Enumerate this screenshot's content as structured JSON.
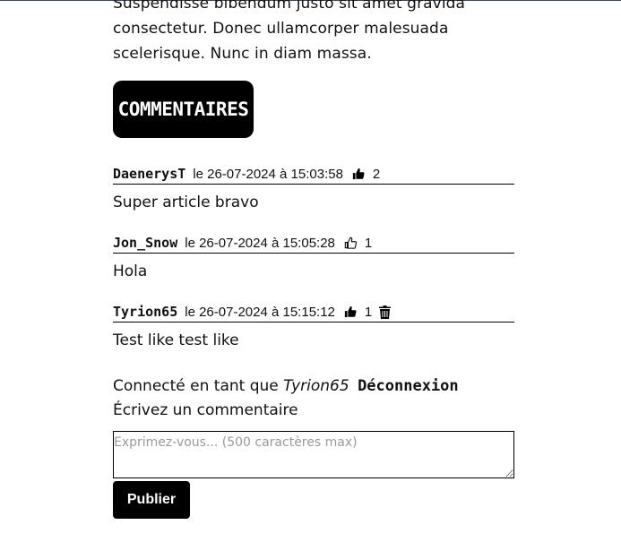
{
  "article": {
    "lines": [
      "Suspendisse bibendum justo sit amet gravida",
      "consectetur. Donec ullamcorper malesuada",
      "scelerisque. Nunc in diam massa."
    ]
  },
  "comments_section": {
    "heading": "COMMENTAIRES",
    "comments": [
      {
        "author": "DaenerysT",
        "date": "le 26-07-2024 à 15:03:58",
        "like_icon": "thumbs-up-filled-icon",
        "likes": "2",
        "text": "Super article bravo"
      },
      {
        "author": "Jon_Snow",
        "date": "le 26-07-2024 à 15:05:28",
        "like_icon": "thumbs-up-outline-icon",
        "likes": "1",
        "text": "Hola"
      },
      {
        "author": "Tyrion65",
        "date": "le 26-07-2024 à 15:15:12",
        "like_icon": "thumbs-up-filled-icon",
        "likes": "1",
        "delete_icon": "trash-icon",
        "text": "Test like test like"
      }
    ]
  },
  "session": {
    "prefix": "Connecté en tant que",
    "username": "Tyrion65",
    "logout_label": "Déconnexion"
  },
  "form": {
    "label": "Écrivez un commentaire",
    "placeholder": "Exprimez-vous... (500 caractères max)",
    "submit_label": "Publier"
  }
}
